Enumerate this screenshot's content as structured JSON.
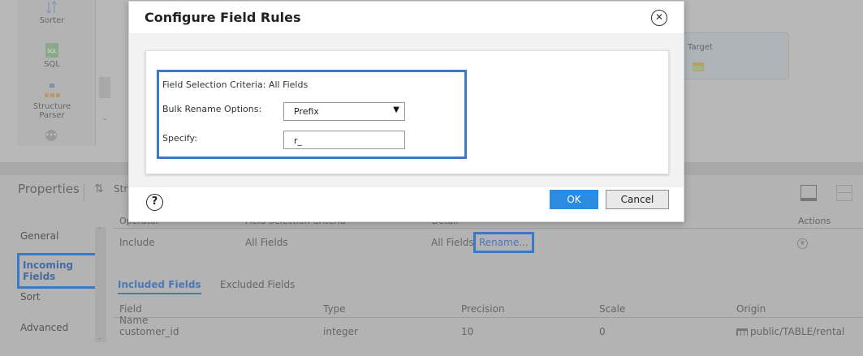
{
  "palette": {
    "items": [
      {
        "label": "Sorter",
        "icon": "sorter-icon"
      },
      {
        "label": "SQL",
        "icon": "sql-icon"
      },
      {
        "label": "Structure Parser",
        "icon": "structure-parser-icon"
      }
    ],
    "sql_badge": "SQL"
  },
  "canvas": {
    "target_label": "Target"
  },
  "properties": {
    "title": "Properties",
    "object_name": "Str"
  },
  "side_nav": {
    "items": [
      "General",
      "Incoming Fields",
      "Sort",
      "Advanced"
    ],
    "active": "Incoming Fields"
  },
  "rules_table": {
    "columns": [
      "Operator",
      "Field Selection Criteria",
      "Detail",
      "Actions"
    ],
    "row": {
      "operator": "Include",
      "criteria": "All Fields",
      "detail": "All Fields",
      "rename": "Rename..."
    }
  },
  "tabs": {
    "included": "Included Fields",
    "excluded": "Excluded Fields"
  },
  "fields_table": {
    "columns": [
      "Field Name",
      "Type",
      "Precision",
      "Scale",
      "Origin"
    ],
    "sort_indicator": "▲",
    "rows": [
      {
        "name": "customer_id",
        "type": "integer",
        "precision": "10",
        "scale": "0",
        "origin": "public/TABLE/rental"
      }
    ]
  },
  "modal": {
    "title": "Configure Field Rules",
    "close_glyph": "✕",
    "criteria_text": "Field Selection Criteria: All Fields",
    "bulk_label": "Bulk Rename Options:",
    "bulk_value": "Prefix",
    "specify_label": "Specify:",
    "specify_value": "r_",
    "help_glyph": "?",
    "ok_label": "OK",
    "cancel_label": "Cancel"
  },
  "colors": {
    "highlight": "#3a78c8",
    "primary_button": "#2a8be0",
    "overlay": "#a9a9a9"
  }
}
